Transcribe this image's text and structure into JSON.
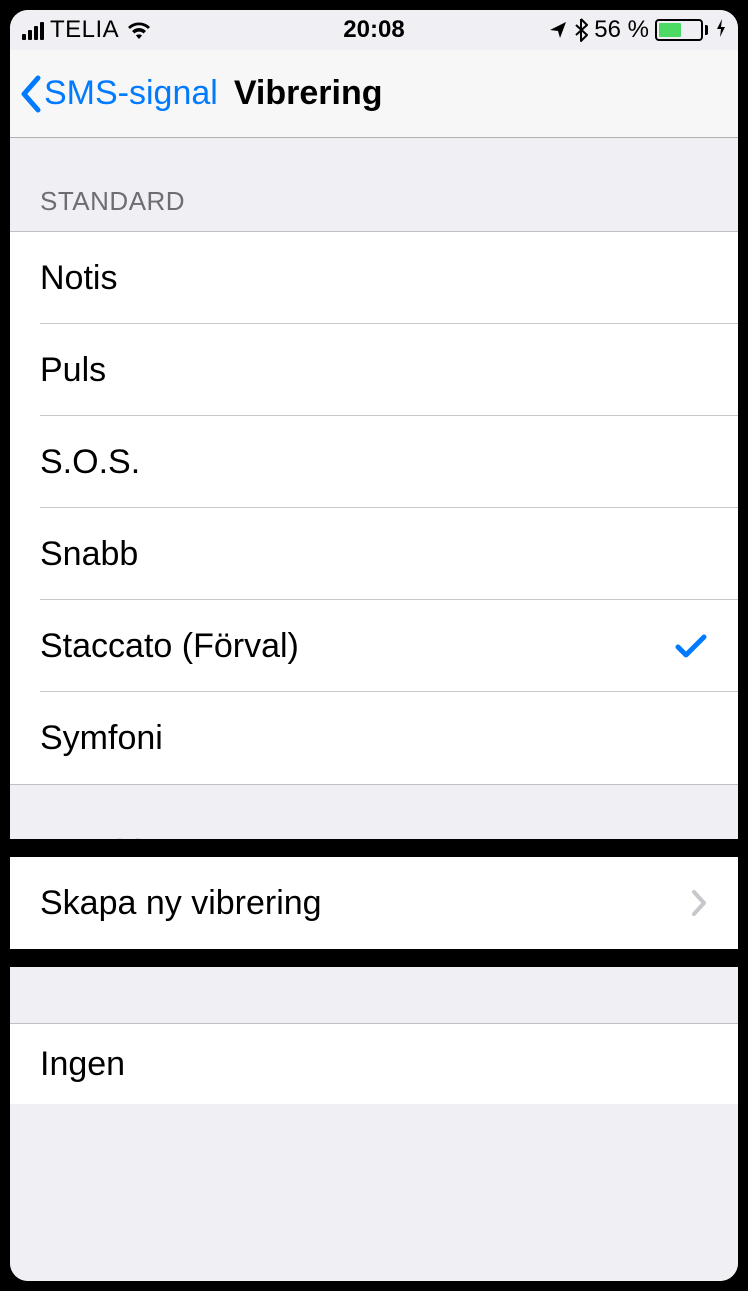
{
  "status_bar": {
    "carrier": "TELIA",
    "time": "20:08",
    "battery_percent": "56 %"
  },
  "nav": {
    "back_label": "SMS-signal",
    "title": "Vibrering"
  },
  "sections": {
    "standard": {
      "header": "Standard",
      "items": [
        {
          "label": "Notis",
          "selected": false
        },
        {
          "label": "Puls",
          "selected": false
        },
        {
          "label": "S.O.S.",
          "selected": false
        },
        {
          "label": "Snabb",
          "selected": false
        },
        {
          "label": "Staccato (Förval)",
          "selected": true
        },
        {
          "label": "Symfoni",
          "selected": false
        }
      ]
    },
    "anpassad": {
      "header": "Anpassad",
      "create_label": "Skapa ny vibrering"
    },
    "none": {
      "label": "Ingen"
    }
  }
}
